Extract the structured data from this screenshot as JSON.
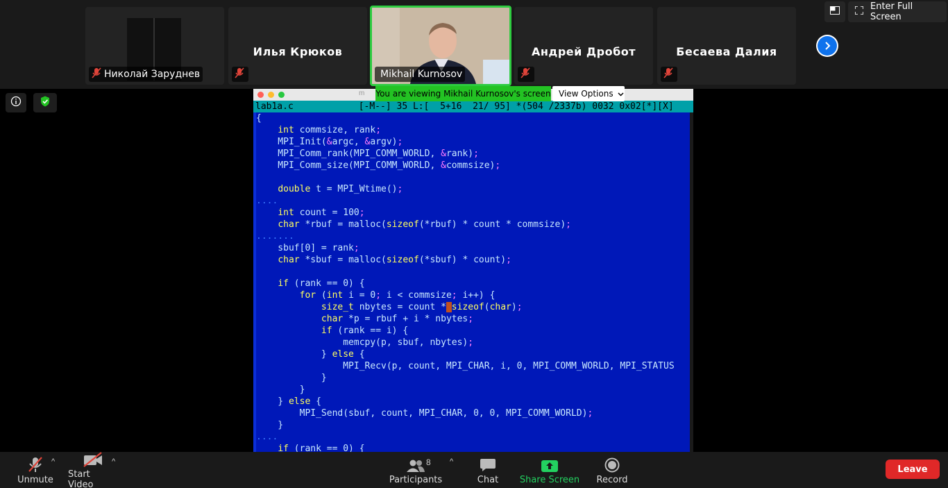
{
  "participants_tiles": [
    {
      "name": "Николай Заруднев",
      "muted": true
    },
    {
      "name": "Илья Крюков",
      "muted": true
    },
    {
      "name": "Mikhail Kurnosov",
      "muted": false
    },
    {
      "name": "Андрей Дробот",
      "muted": true
    },
    {
      "name": "Бесаева Далия",
      "muted": true
    }
  ],
  "top_controls": {
    "fullscreen_label": "Enter Full Screen"
  },
  "banner": {
    "viewing_text": "You are viewing Mikhail Kurnosov's screen",
    "view_options_label": "View Options"
  },
  "editor": {
    "window_title_fragment": "m",
    "status_line": "lab1a.c            [-M--] 35 L:[  5+16  21/ 95] *(504 /2337b) 0032 0x02[*][X]",
    "lines": [
      "{",
      "    int commsize, rank;",
      "    MPI_Init(&argc, &argv);",
      "    MPI_Comm_rank(MPI_COMM_WORLD, &rank);",
      "    MPI_Comm_size(MPI_COMM_WORLD, &commsize);",
      "",
      "    double t = MPI_Wtime();",
      "....",
      "    int count = 100;",
      "    char *rbuf = malloc(sizeof(*rbuf) * count * commsize);",
      ".......",
      "    sbuf[0] = rank;",
      "    char *sbuf = malloc(sizeof(*sbuf) * count);",
      "",
      "    if (rank == 0) {",
      "        for (int i = 0; i < commsize; i++) {",
      "            size_t nbytes = count * sizeof(char);",
      "            char *p = rbuf + i * nbytes;",
      "            if (rank == i) {",
      "                memcpy(p, sbuf, nbytes);",
      "            } else {",
      "                MPI_Recv(p, count, MPI_CHAR, i, 0, MPI_COMM_WORLD, MPI_STATUS",
      "            }",
      "        }",
      "    } else {",
      "        MPI_Send(sbuf, count, MPI_CHAR, 0, 0, MPI_COMM_WORLD);",
      "    }",
      "....",
      "    if (rank == 0) {"
    ]
  },
  "toolbar": {
    "unmute_label": "Unmute",
    "start_video_label": "Start Video",
    "participants_label": "Participants",
    "participants_count": "8",
    "chat_label": "Chat",
    "share_screen_label": "Share Screen",
    "record_label": "Record",
    "leave_label": "Leave"
  },
  "colors": {
    "editor_bg": "#0018b8",
    "status_bg": "#00a0a8",
    "keyword": "#ffff60",
    "banner_green": "#23c223",
    "share_green": "#23d160",
    "leave_red": "#e02828",
    "accent_blue": "#0e72ed"
  }
}
